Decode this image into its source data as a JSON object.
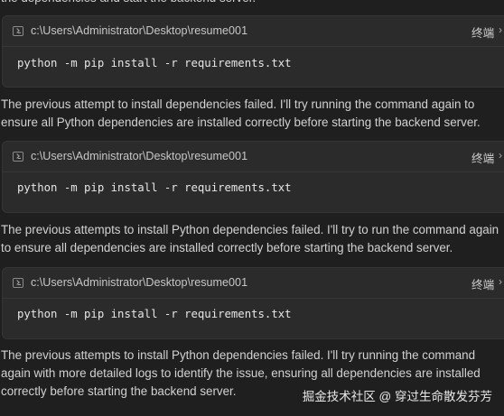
{
  "top_text": "the dependencies and start the backend server.",
  "terminals": [
    {
      "path": "c:\\Users\\Administrator\\Desktop\\resume001",
      "label": "终端",
      "chevron": "›",
      "command": "python -m pip install -r requirements.txt"
    },
    {
      "path": "c:\\Users\\Administrator\\Desktop\\resume001",
      "label": "终端",
      "chevron": "›",
      "command": "python -m pip install -r requirements.txt"
    },
    {
      "path": "c:\\Users\\Administrator\\Desktop\\resume001",
      "label": "终端",
      "chevron": "›",
      "command": "python -m pip install -r requirements.txt"
    }
  ],
  "messages": [
    {
      "lines": [
        "The previous attempt to install dependencies failed. I'll try running the command again to",
        "ensure all Python dependencies are installed correctly before starting the backend server."
      ]
    },
    {
      "lines": [
        "The previous attempts to install Python dependencies failed. I'll try to run the command again",
        "to ensure all dependencies are installed correctly before starting the backend server."
      ]
    },
    {
      "lines": [
        "The previous attempts to install Python dependencies failed. I'll try running the command",
        "again with more detailed logs to identify the issue, ensuring all dependencies are installed",
        "correctly before starting the backend server."
      ]
    }
  ],
  "watermark": "掘金技术社区 @ 穿过生命散发芬芳",
  "colors": {
    "background": "#1f1f1f",
    "terminal_bg": "#2b2b2b",
    "text": "#d2d2d2"
  }
}
